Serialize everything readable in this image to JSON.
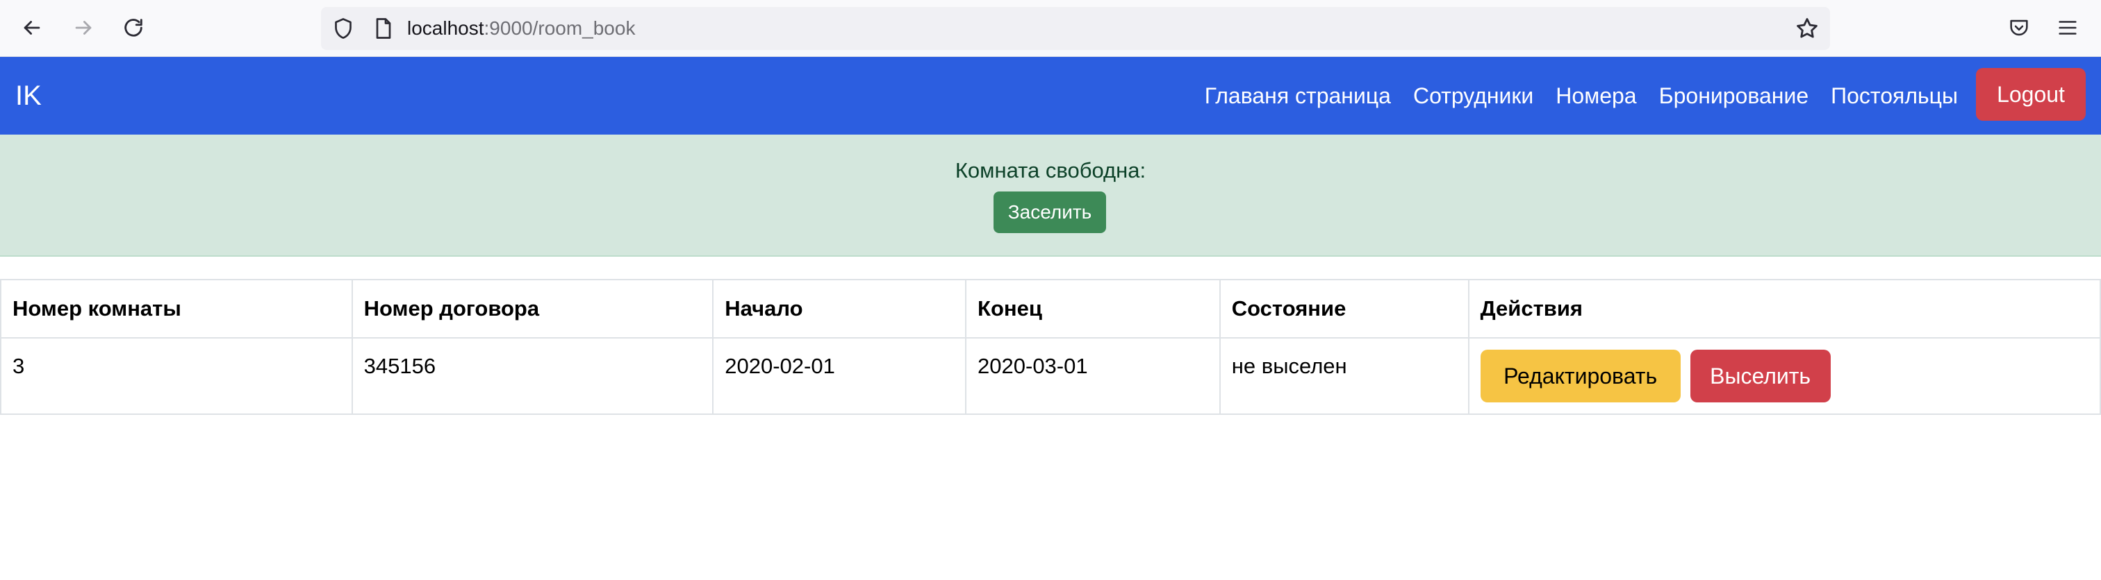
{
  "browser": {
    "url_host": "localhost",
    "url_path": ":9000/room_book",
    "icons": [
      "back-arrow-icon",
      "forward-arrow-icon",
      "reload-icon",
      "shield-icon",
      "page-icon",
      "star-icon",
      "pocket-icon",
      "hamburger-menu-icon"
    ]
  },
  "navbar": {
    "brand": "IK",
    "links": [
      "Главаня страница",
      "Сотрудники",
      "Номера",
      "Бронирование",
      "Постояльцы"
    ],
    "logout_label": "Logout",
    "bg_color": "#2c5ee0"
  },
  "alert": {
    "text": "Комната свободна:",
    "button_label": "Заселить",
    "bg_color": "#d4e7dd"
  },
  "table": {
    "headers": [
      "Номер комнаты",
      "Номер договора",
      "Начало",
      "Конец",
      "Состояние",
      "Действия"
    ],
    "rows": [
      {
        "room": "3",
        "contract": "345156",
        "start": "2020-02-01",
        "end": "2020-03-01",
        "status": "не выселен",
        "edit_label": "Редактировать",
        "evict_label": "Выселить"
      }
    ]
  },
  "colors": {
    "primary": "#2c5ee0",
    "danger": "#d1404a",
    "warning": "#f6c444",
    "success": "#3d8a57"
  }
}
